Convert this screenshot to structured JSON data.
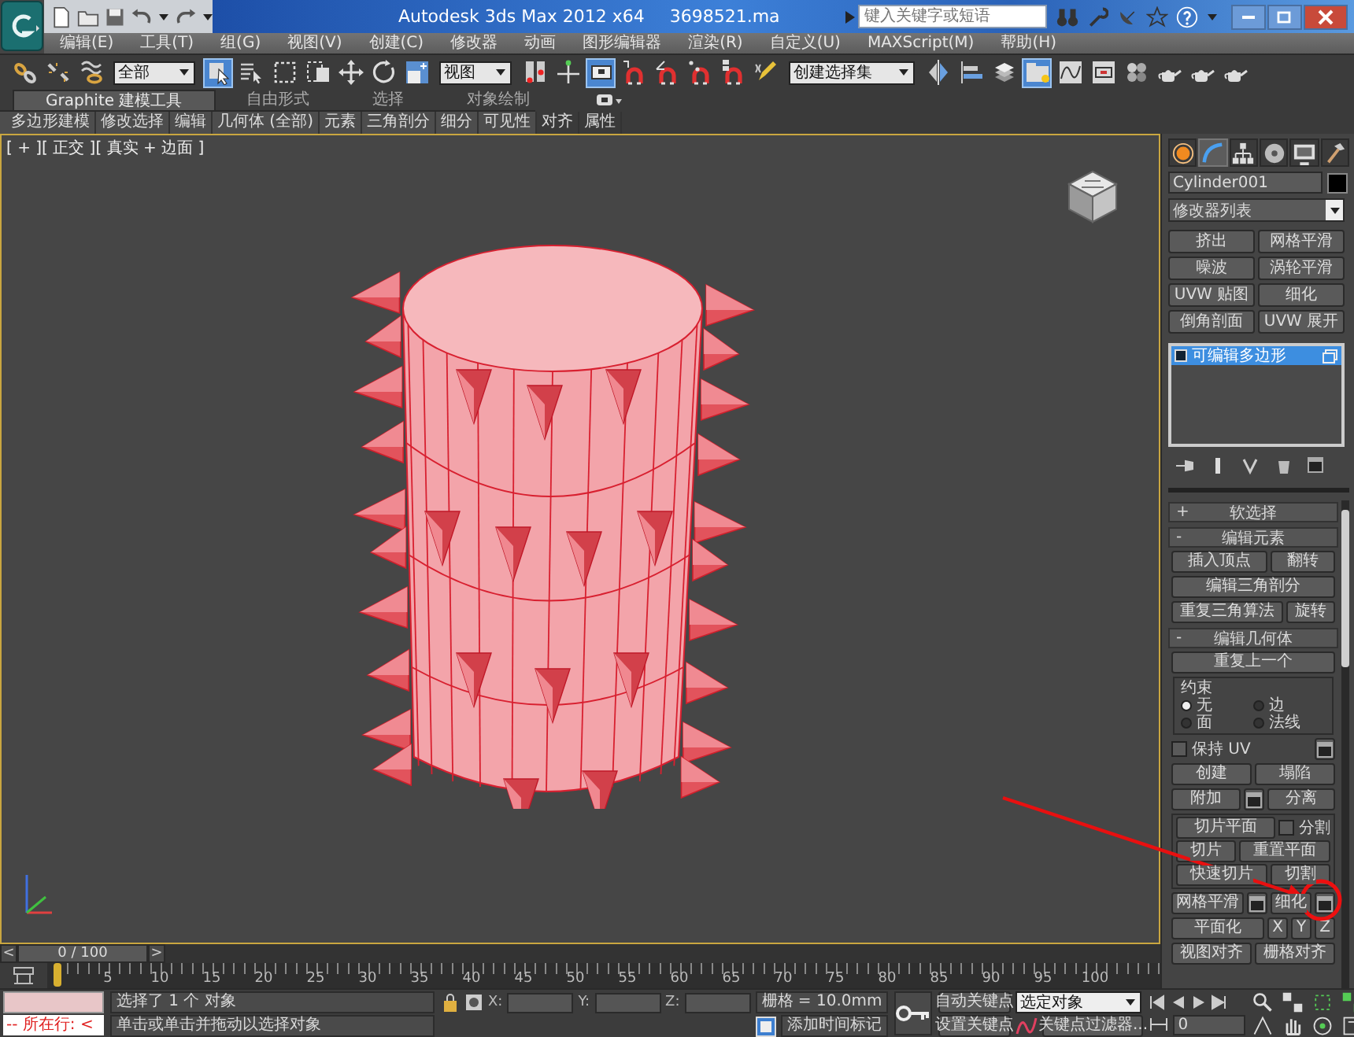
{
  "window": {
    "title": "Autodesk 3ds Max 2012 x64",
    "file_name": "3698521.ma",
    "search": {
      "placeholder": "键入关键字或短语"
    }
  },
  "menu": [
    "编辑(E)",
    "工具(T)",
    "组(G)",
    "视图(V)",
    "创建(C)",
    "修改器",
    "动画",
    "图形编辑器",
    "渲染(R)",
    "自定义(U)",
    "MAXScript(M)",
    "帮助(H)"
  ],
  "toolbar": [
    {
      "kind": "tool",
      "pressed": false
    },
    {
      "kind": "tool",
      "pressed": false
    },
    {
      "kind": "tool",
      "pressed": false
    },
    {
      "kind": "dropdown",
      "value": "全部"
    },
    {
      "kind": "tool",
      "pressed": true
    },
    {
      "kind": "tool",
      "pressed": false
    },
    {
      "kind": "tool",
      "pressed": false
    },
    {
      "kind": "tool",
      "pressed": false
    },
    {
      "kind": "tool",
      "pressed": false
    },
    {
      "kind": "tool",
      "pressed": false
    },
    {
      "kind": "tool",
      "pressed": false
    },
    {
      "kind": "dropdown",
      "value": "视图"
    },
    {
      "kind": "tool",
      "pressed": false
    },
    {
      "kind": "tool",
      "pressed": false
    },
    {
      "kind": "tool",
      "pressed": true
    },
    {
      "kind": "tool",
      "pressed": false
    },
    {
      "kind": "tool",
      "pressed": false
    },
    {
      "kind": "tool",
      "pressed": false
    },
    {
      "kind": "tool",
      "pressed": false
    },
    {
      "kind": "tool",
      "pressed": false
    },
    {
      "kind": "dropdown",
      "value": "创建选择集"
    },
    {
      "kind": "tool",
      "pressed": false
    },
    {
      "kind": "tool",
      "pressed": false
    },
    {
      "kind": "tool",
      "pressed": false
    },
    {
      "kind": "tool",
      "pressed": true
    },
    {
      "kind": "tool",
      "pressed": false
    },
    {
      "kind": "tool",
      "pressed": false
    },
    {
      "kind": "tool",
      "pressed": false
    },
    {
      "kind": "tool",
      "pressed": false
    },
    {
      "kind": "tool",
      "pressed": false
    },
    {
      "kind": "tool",
      "pressed": false
    }
  ],
  "ribbon": {
    "tabs": [
      {
        "label": "Graphite 建模工具",
        "selected": true
      },
      {
        "label": "自由形式",
        "selected": false
      },
      {
        "label": "选择",
        "selected": false
      },
      {
        "label": "对象绘制",
        "selected": false
      }
    ],
    "panels": [
      "多边形建模",
      "修改选择",
      "编辑",
      "几何体 (全部)",
      "元素",
      "三角剖分",
      "细分",
      "可见性",
      "对齐",
      "属性"
    ]
  },
  "viewport": {
    "label": "[ + ][ 正交 ][ 真实 + 边面 ]"
  },
  "command_panel": {
    "tabs": [
      {
        "selected": false
      },
      {
        "selected": true
      },
      {
        "selected": false
      },
      {
        "selected": false
      },
      {
        "selected": false
      },
      {
        "selected": false
      }
    ],
    "object_name": "Cylinder001",
    "modifier_list": "修改器列表",
    "modifier_buttons": [
      "挤出",
      "网格平滑",
      "噪波",
      "涡轮平滑",
      "UVW 贴图",
      "细化",
      "倒角剖面",
      "UVW 展开"
    ],
    "stack": [
      {
        "label": "可编辑多边形",
        "selected": true
      }
    ],
    "rollouts": [
      {
        "toggle": "+",
        "title": "软选择"
      },
      {
        "toggle": "-",
        "title": "编辑元素",
        "rows": [
          {
            "kind": "row",
            "items": [
              {
                "kind": "button",
                "label": "插入顶点"
              },
              {
                "kind": "button",
                "label": "翻转"
              }
            ]
          },
          {
            "kind": "row",
            "items": [
              {
                "kind": "button",
                "label": "编辑三角剖分"
              }
            ]
          },
          {
            "kind": "row",
            "items": [
              {
                "kind": "button",
                "label": "重复三角算法"
              },
              {
                "kind": "button",
                "label": "旋转"
              }
            ]
          }
        ]
      },
      {
        "toggle": "-",
        "title": "编辑几何体",
        "rows": [
          {
            "kind": "row",
            "items": [
              {
                "kind": "button",
                "label": "重复上一个"
              }
            ]
          },
          {
            "kind": "radio_group",
            "title": "约束",
            "options": [
              {
                "label": "无",
                "selected": true
              },
              {
                "label": "边",
                "selected": false
              },
              {
                "label": "面",
                "selected": false
              },
              {
                "label": "法线",
                "selected": false
              }
            ]
          },
          {
            "kind": "row",
            "items": [
              {
                "kind": "checkbox",
                "label": "保持 UV",
                "checked": false
              },
              {
                "kind": "settings"
              }
            ]
          },
          {
            "kind": "row",
            "items": [
              {
                "kind": "button",
                "label": "创建"
              },
              {
                "kind": "button",
                "label": "塌陷"
              }
            ]
          },
          {
            "kind": "row",
            "items": [
              {
                "kind": "button",
                "label": "附加"
              },
              {
                "kind": "settings"
              },
              {
                "kind": "button",
                "label": "分离"
              }
            ]
          },
          {
            "kind": "frame",
            "rows": [
              {
                "kind": "row",
                "items": [
                  {
                    "kind": "button",
                    "label": "切片平面"
                  },
                  {
                    "kind": "checkbox",
                    "label": "分割",
                    "checked": false
                  }
                ]
              },
              {
                "kind": "row",
                "items": [
                  {
                    "kind": "button",
                    "label": "切片"
                  },
                  {
                    "kind": "button",
                    "label": "重置平面"
                  }
                ]
              },
              {
                "kind": "row",
                "items": [
                  {
                    "kind": "button",
                    "label": "快速切片"
                  },
                  {
                    "kind": "button",
                    "label": "切割"
                  }
                ]
              }
            ]
          },
          {
            "kind": "row",
            "items": [
              {
                "kind": "button",
                "label": "网格平滑"
              },
              {
                "kind": "settings"
              },
              {
                "kind": "button",
                "label": "细化"
              },
              {
                "kind": "settings"
              }
            ]
          },
          {
            "kind": "row",
            "items": [
              {
                "kind": "button",
                "label": "平面化"
              },
              {
                "kind": "axis",
                "label": "X"
              },
              {
                "kind": "axis",
                "label": "Y"
              },
              {
                "kind": "axis",
                "label": "Z"
              }
            ]
          },
          {
            "kind": "row",
            "items": [
              {
                "kind": "button",
                "label": "视图对齐"
              },
              {
                "kind": "button",
                "label": "栅格对齐"
              }
            ]
          }
        ]
      }
    ]
  },
  "timeline": {
    "slider": {
      "label": "0 / 100",
      "prev": "<",
      "next": ">"
    },
    "ruler_labels": [
      "5",
      "10",
      "15",
      "20",
      "25",
      "30",
      "35",
      "40",
      "45",
      "50",
      "55",
      "60",
      "65",
      "70",
      "75",
      "80",
      "85",
      "90",
      "95",
      "100"
    ]
  },
  "status_bar": {
    "listener_output": "-- 所在行: <",
    "prompt": "选择了 1 个 对象",
    "hint": "单击或单击并拖动以选择对象",
    "coordinates": [
      "X:",
      "Y:",
      "Z:"
    ],
    "grid": "栅格 = 10.0mm",
    "time_tag": "添加时间标记",
    "auto_key": "自动关键点",
    "key_target": "选定对象",
    "set_key": "设置关键点",
    "key_filters": "关键点过滤器...",
    "frame": "0"
  }
}
